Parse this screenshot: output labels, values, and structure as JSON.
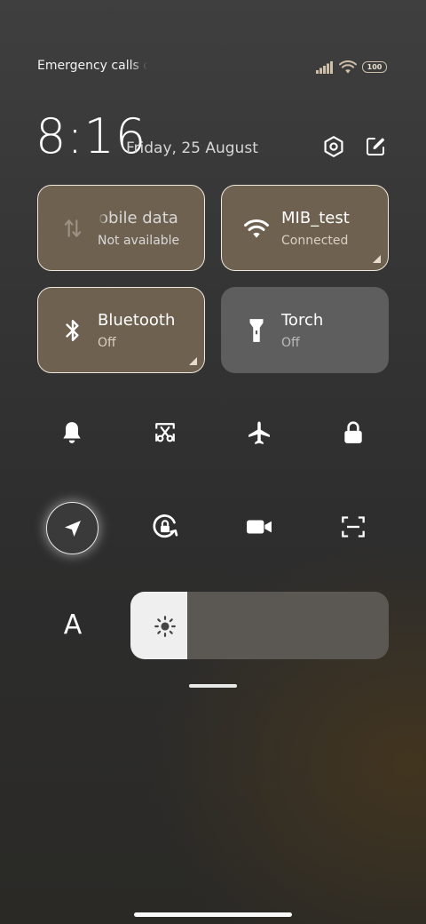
{
  "status_bar": {
    "carrier_text": "Emergency calls o",
    "battery_level": "100"
  },
  "header": {
    "time": "8:16",
    "date": "Friday, 25 August"
  },
  "tiles": {
    "mobile_data": {
      "title": "obile data",
      "subtitle": "Not available",
      "active": true
    },
    "wifi": {
      "title": "MIB_test",
      "subtitle": "Connected",
      "active": true
    },
    "bluetooth": {
      "title": "Bluetooth",
      "subtitle": "Off",
      "active": true
    },
    "torch": {
      "title": "Torch",
      "subtitle": "Off",
      "active": false
    }
  },
  "quick_buttons_row1": [
    "bell-icon",
    "screenshot-icon",
    "airplane-icon",
    "lock-icon"
  ],
  "quick_buttons_row2": [
    "location-icon",
    "rotation-lock-icon",
    "video-camera-icon",
    "scanner-icon"
  ],
  "font_button": {
    "label": "A"
  },
  "brightness": {
    "level_fraction": 0.22
  },
  "colors": {
    "active_tile": "#6e6150",
    "inactive_tile": "#5e5e5e",
    "brightness_track": "#5b5752"
  }
}
